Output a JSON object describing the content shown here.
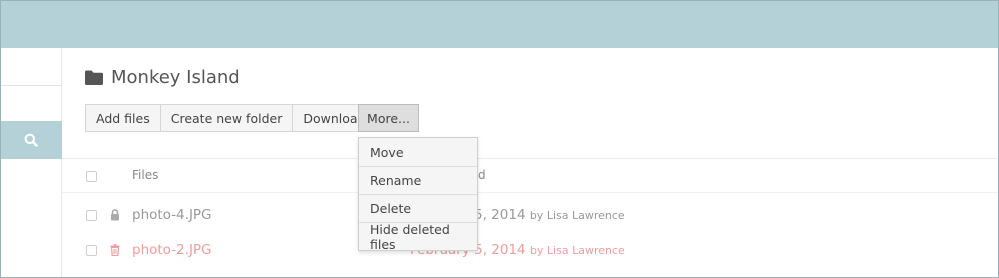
{
  "folder": {
    "title": "Monkey Island",
    "icon": "folder-icon"
  },
  "toolbar": {
    "add_files": "Add files",
    "create_folder": "Create new folder",
    "download": "Download",
    "more": "More..."
  },
  "more_menu": {
    "items": [
      "Move",
      "Rename",
      "Delete",
      "Hide deleted files"
    ]
  },
  "table": {
    "header_files": "Files",
    "header_modified_fragment": "d",
    "rows": [
      {
        "name": "photo-4.JPG",
        "date": "5, 2014",
        "by": "by Lisa Lawrence",
        "icon": "lock-icon",
        "deleted": false
      },
      {
        "name": "photo-2.JPG",
        "date": "February 5, 2014",
        "by": "by Lisa Lawrence",
        "icon": "trash-icon",
        "deleted": true
      }
    ]
  },
  "sidebar": {
    "search_icon": "search-icon"
  },
  "colors": {
    "accent": "#b4d1d8",
    "deleted_text": "#ee9d9d",
    "text_muted": "#999999"
  }
}
